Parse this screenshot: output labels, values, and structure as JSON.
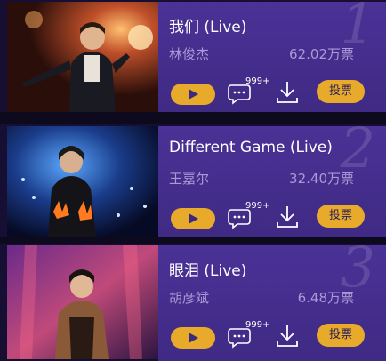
{
  "songs": [
    {
      "rank": "1",
      "title": "我们 (Live)",
      "singer": "林俊杰",
      "votes": "62.02万票",
      "comment_count": "999+",
      "vote_label": "投票"
    },
    {
      "rank": "2",
      "title": "Different Game (Live)",
      "singer": "王嘉尔",
      "votes": "32.40万票",
      "comment_count": "999+",
      "vote_label": "投票"
    },
    {
      "rank": "3",
      "title": "眼泪 (Live)",
      "singer": "胡彦斌",
      "votes": "6.48万票",
      "comment_count": "999+",
      "vote_label": "投票"
    }
  ],
  "icons": {
    "play": "play-icon",
    "comment": "comment-icon",
    "download": "download-icon"
  },
  "colors": {
    "accent": "#e8aa2a",
    "panel": "#4a3296",
    "muted_text": "#a99ad6"
  }
}
